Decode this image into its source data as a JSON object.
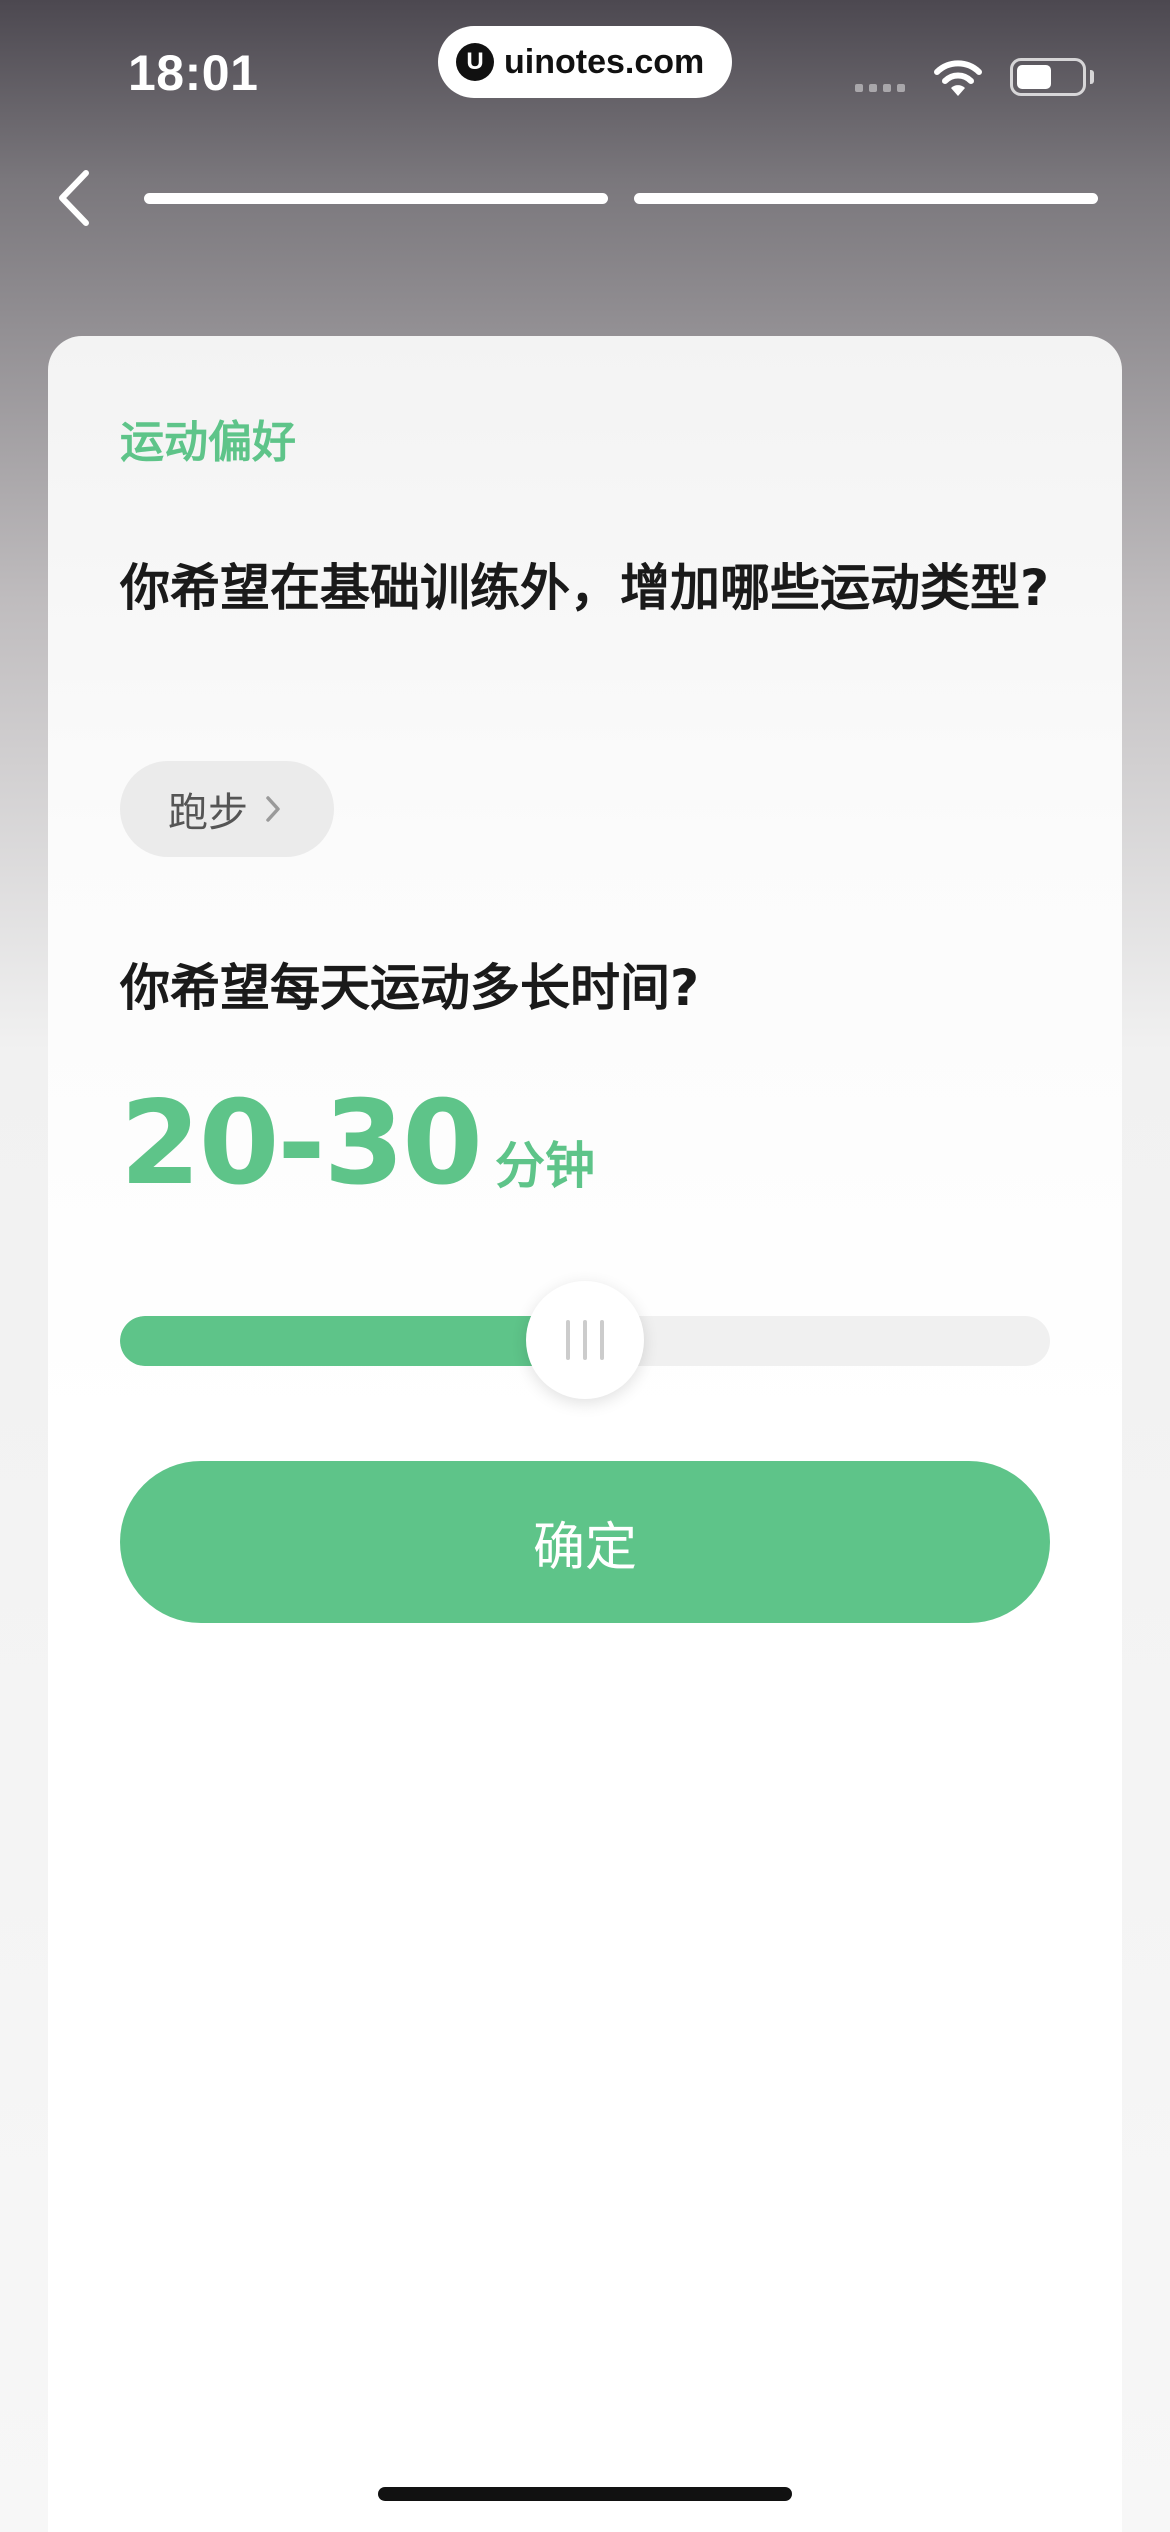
{
  "status_bar": {
    "time": "18:01",
    "url": "uinotes.com",
    "url_logo": "U",
    "icons": [
      "signal-icon",
      "wifi-icon",
      "battery-icon"
    ]
  },
  "nav": {
    "back_icon": "chevron-left-icon",
    "progress_steps": 2,
    "current_step": 2
  },
  "card": {
    "section_label": "运动偏好",
    "question_1": "你希望在基础训练外，增加哪些运动类型?",
    "chip_label": "跑步",
    "question_2": "你希望每天运动多长时间?",
    "duration_value": "20-30",
    "duration_unit": "分钟",
    "slider_level": 0.5,
    "confirm_label": "确定"
  },
  "colors": {
    "accent": "#5ec489",
    "text": "#1a1a1a",
    "chip_bg": "#ebebeb"
  }
}
